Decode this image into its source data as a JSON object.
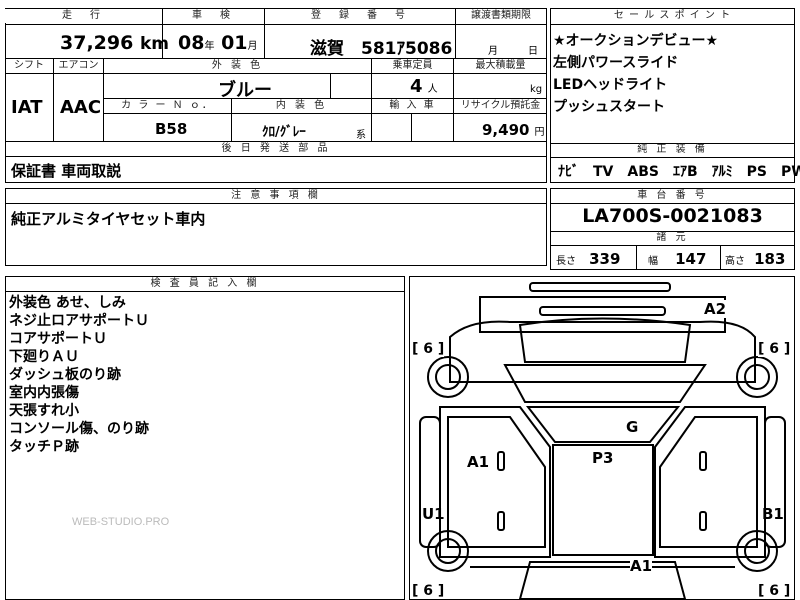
{
  "top": {
    "headers": {
      "mileage": "走　行",
      "inspection": "車　検",
      "plate": "登　録　番　号",
      "transfer": "譲渡書類期限",
      "sales_point": "セ ー ル ス ポ イ ン ト"
    },
    "mileage_value": "37,296",
    "mileage_unit": "km",
    "inspection_year": "08",
    "inspection_year_unit": "年",
    "inspection_month": "01",
    "inspection_month_unit": "月",
    "plate": "滋賀　581ｱ5086",
    "transfer_month_unit": "月",
    "transfer_day_unit": "日"
  },
  "row2": {
    "headers": {
      "shift": "シフト",
      "aircon": "エアコン",
      "exterior_color": "外 装 色",
      "capacity": "乗車定員",
      "max_load": "最大積載量"
    },
    "shift": "IAT",
    "aircon": "AAC",
    "exterior_color": "ブルー",
    "capacity": "4",
    "capacity_unit": "人",
    "max_load_unit": "kg"
  },
  "row3": {
    "headers": {
      "color_no": "カ ラ ー Ｎ ｏ．",
      "interior_color": "内 装 色",
      "import": "輸 入 車",
      "recycle": "リサイクル預託金"
    },
    "color_no": "B58",
    "interior_color": "ｸﾛ/ｸﾞﾚｰ",
    "interior_suffix": "系",
    "recycle": "9,490",
    "recycle_unit": "円"
  },
  "sales_points": [
    "★オークションデビュー★",
    "左側パワースライド",
    "LEDヘッドライト",
    "プッシュスタート"
  ],
  "genuine_equipment": {
    "header": "純 正 装 備",
    "items": "ﾅﾋﾞ　TV　ABS　ｴｱB　ｱﾙﾐ　PS　PW"
  },
  "later_parts": {
    "header": "後 日 発 送 部 品",
    "text": "保証書 車両取説"
  },
  "notes": {
    "header": "注 意 事 項 欄",
    "text": "純正アルミタイヤセット車内"
  },
  "chassis": {
    "header": "車 台 番 号",
    "value": "LA700S-0021083"
  },
  "specs": {
    "header": "諸 元",
    "length_label": "長さ",
    "length": "339",
    "width_label": "幅",
    "width": "147",
    "height_label": "高さ",
    "height": "183"
  },
  "inspector": {
    "header": "検 査 員 記 入 欄",
    "lines": [
      "外装色 あせ、しみ",
      "ネジ止ロアサポートＵ",
      "コアサポートＵ",
      "下廻りＡＵ",
      "ダッシュ板のり跡",
      "室内内張傷",
      "天張すれ小",
      "コンソール傷、のり跡",
      "タッチＰ跡"
    ]
  },
  "watermark": "WEB-STUDIO.PRO",
  "diagram": {
    "tire_marks": [
      "[ 6 ]",
      "[ 6 ]",
      "[ 6 ]",
      "[ 6 ]"
    ],
    "damage_codes": {
      "front_right": "A2",
      "left_door": "A1",
      "center": "P3",
      "glass": "G",
      "left_rear": "U1",
      "right_rear": "B1",
      "rear": "A1"
    }
  }
}
